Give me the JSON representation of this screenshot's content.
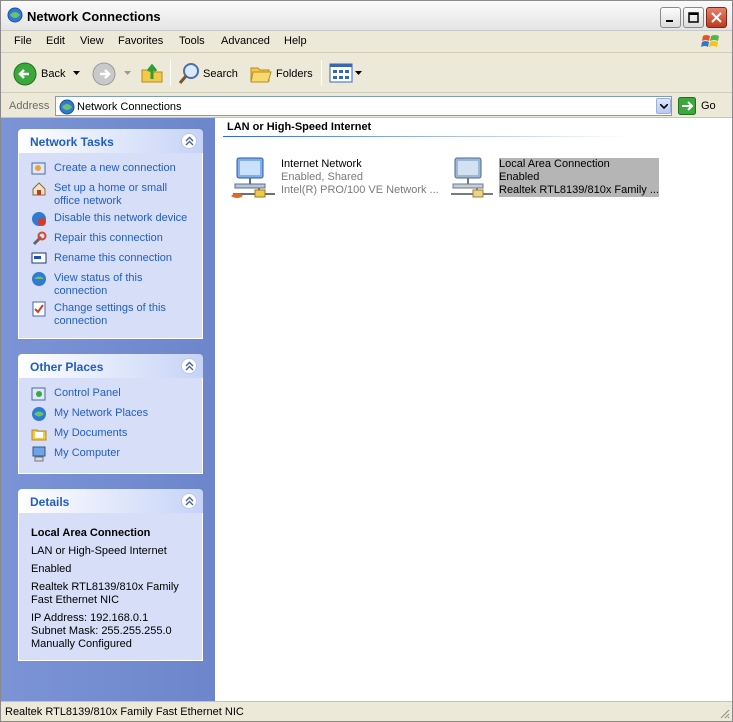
{
  "window": {
    "title": "Network Connections"
  },
  "menu": [
    "File",
    "Edit",
    "View",
    "Favorites",
    "Tools",
    "Advanced",
    "Help"
  ],
  "toolbar": {
    "back": "Back",
    "search": "Search",
    "folders": "Folders"
  },
  "address": {
    "label": "Address",
    "value": "Network Connections",
    "go": "Go"
  },
  "network_tasks": {
    "title": "Network Tasks",
    "items": [
      {
        "icon": "new-connection-icon",
        "label": "Create a new connection"
      },
      {
        "icon": "home-network-icon",
        "label": "Set up a home or small office network"
      },
      {
        "icon": "disable-device-icon",
        "label": "Disable this network device"
      },
      {
        "icon": "repair-icon",
        "label": "Repair this connection"
      },
      {
        "icon": "rename-icon",
        "label": "Rename this connection"
      },
      {
        "icon": "status-icon",
        "label": "View status of this connection"
      },
      {
        "icon": "settings-icon",
        "label": "Change settings of this connection"
      }
    ]
  },
  "other_places": {
    "title": "Other Places",
    "items": [
      {
        "icon": "control-panel-icon",
        "label": "Control Panel"
      },
      {
        "icon": "network-places-icon",
        "label": "My Network Places"
      },
      {
        "icon": "documents-icon",
        "label": "My Documents"
      },
      {
        "icon": "computer-icon",
        "label": "My Computer"
      }
    ]
  },
  "details": {
    "title": "Details",
    "name": "Local Area Connection",
    "type": "LAN or High-Speed Internet",
    "status": "Enabled",
    "device_line1": "Realtek RTL8139/810x Family",
    "device_line2": "Fast Ethernet NIC",
    "ip": "IP Address: 192.168.0.1",
    "subnet": "Subnet Mask: 255.255.255.0",
    "config": "Manually Configured"
  },
  "content": {
    "group_title": "LAN or High-Speed Internet",
    "connections": [
      {
        "name": "Internet Network",
        "status": "Enabled, Shared",
        "device": "Intel(R) PRO/100 VE Network ...",
        "selected": false
      },
      {
        "name": "Local Area Connection",
        "status": "Enabled",
        "device": "Realtek RTL8139/810x Family ...",
        "selected": true
      }
    ]
  },
  "status_bar": {
    "text": "Realtek RTL8139/810x Family Fast Ethernet NIC"
  }
}
